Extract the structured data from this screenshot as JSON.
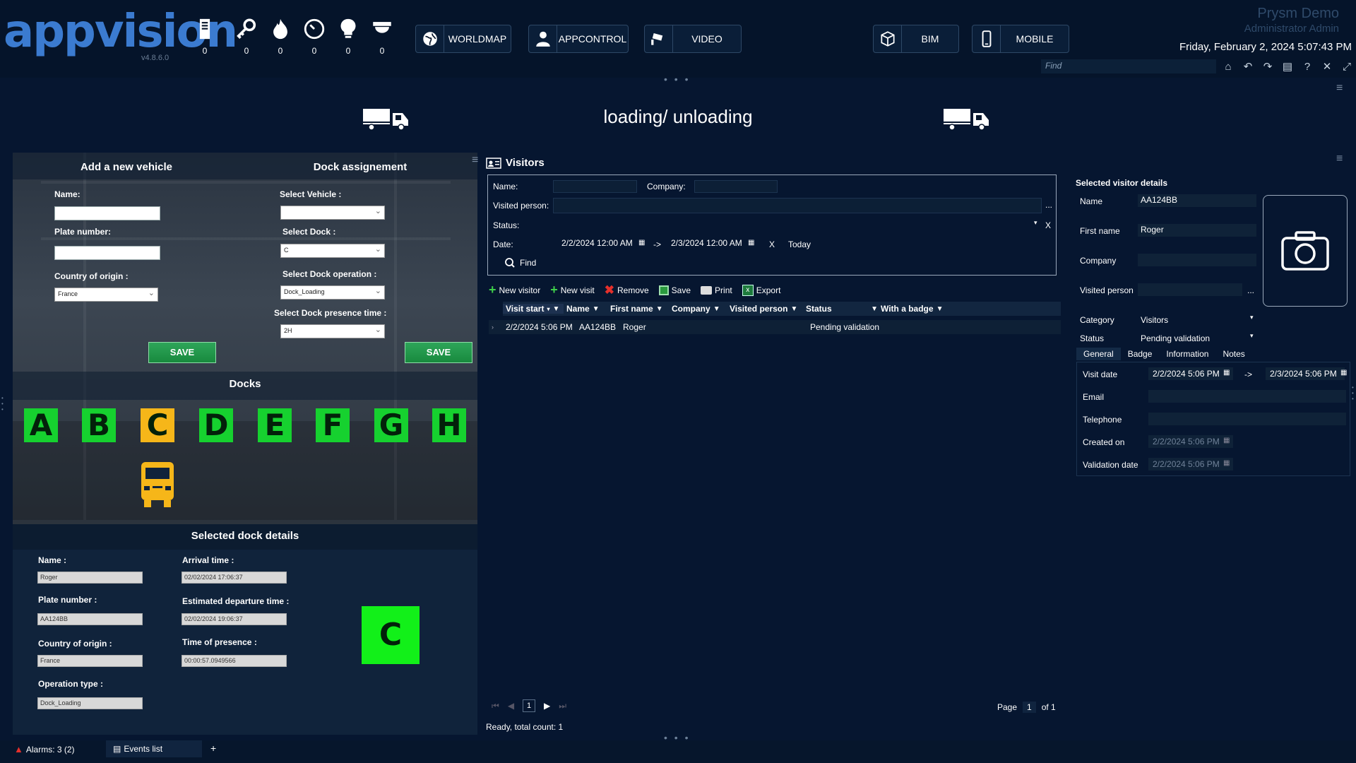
{
  "app": {
    "logo": "appvision",
    "version": "v4.8.6.0",
    "name": "Prysm Demo",
    "user": "Administrator Admin",
    "datetime": "Friday, February 2, 2024 5:07:43 PM",
    "find_placeholder": "Find"
  },
  "counters": [
    {
      "icon": "server-icon",
      "value": "0"
    },
    {
      "icon": "key-icon",
      "value": "0"
    },
    {
      "icon": "fire-icon",
      "value": "0"
    },
    {
      "icon": "gauge-icon",
      "value": "0"
    },
    {
      "icon": "lightbulb-icon",
      "value": "0"
    },
    {
      "icon": "camera-dome-icon",
      "value": "0"
    }
  ],
  "nav": {
    "worldmap": "WORLDMAP",
    "appcontrol": "APPCONTROL",
    "video": "VIDEO",
    "bim": "BIM",
    "mobile": "MOBILE"
  },
  "page": {
    "title": "loading/ unloading"
  },
  "vehicle": {
    "title": "Add a new vehicle",
    "name_label": "Name:",
    "plate_label": "Plate number:",
    "country_label": "Country of origin :",
    "country_value": "France",
    "save": "SAVE"
  },
  "dock_assign": {
    "title": "Dock assignement",
    "vehicle_label": "Select Vehicle :",
    "vehicle_value": "",
    "dock_label": "Select Dock :",
    "dock_value": "C",
    "operation_label": "Select Dock operation :",
    "operation_value": "Dock_Loading",
    "presence_label": "Select Dock presence time :",
    "presence_value": "2H",
    "save": "SAVE"
  },
  "docks": {
    "title": "Docks",
    "items": [
      "A",
      "B",
      "C",
      "D",
      "E",
      "F",
      "G",
      "H"
    ],
    "selected": "C",
    "colors": {
      "free": "#16d12f",
      "occupied": "#f6b619"
    }
  },
  "dock_details": {
    "title": "Selected dock details",
    "name_label": "Name :",
    "name_value": "Roger",
    "plate_label": "Plate number :",
    "plate_value": "AA124BB",
    "country_label": "Country of origin :",
    "country_value": "France",
    "operation_label": "Operation type :",
    "operation_value": "Dock_Loading",
    "arrival_label": "Arrival time :",
    "arrival_value": "02/02/2024 17:06:37",
    "departure_label": "Estimated departure time :",
    "departure_value": "02/02/2024 19:06:37",
    "presence_label": "Time of presence :",
    "presence_value": "00:00:57.0949566",
    "dock": "C"
  },
  "visitors": {
    "title": "Visitors",
    "filter": {
      "name_label": "Name:",
      "company_label": "Company:",
      "visited_label": "Visited person:",
      "status_label": "Status:",
      "date_label": "Date:",
      "date_from": "2/2/2024 12:00 AM",
      "arrow": "->",
      "date_to": "2/3/2024 12:00 AM",
      "clear": "X",
      "today": "Today",
      "find": "Find",
      "more": "...",
      "status_clear": "X"
    },
    "toolbar": {
      "new_visitor": "New visitor",
      "new_visit": "New visit",
      "remove": "Remove",
      "save": "Save",
      "print": "Print",
      "export": "Export"
    },
    "columns": [
      "Visit start",
      "Name",
      "First name",
      "Company",
      "Visited person",
      "Status",
      "With a badge"
    ],
    "rows": [
      {
        "visit_start": "2/2/2024 5:06 PM",
        "name": "AA124BB",
        "first_name": "Roger",
        "company": "",
        "visited_person": "",
        "status": "Pending validation",
        "badge": ""
      }
    ],
    "pager": {
      "current": "1",
      "page_label": "Page",
      "page_value": "1",
      "of_label": "of 1"
    },
    "status": "Ready, total count: 1"
  },
  "details": {
    "title": "Selected visitor details",
    "name_label": "Name",
    "name_value": "AA124BB",
    "first_label": "First name",
    "first_value": "Roger",
    "company_label": "Company",
    "company_value": "",
    "visited_label": "Visited person",
    "visited_value": "",
    "more": "...",
    "category_label": "Category",
    "category_value": "Visitors",
    "status_label": "Status",
    "status_value": "Pending validation",
    "tabs": [
      "General",
      "Badge",
      "Information",
      "Notes"
    ],
    "general": {
      "visit_label": "Visit date",
      "visit_from": "2/2/2024 5:06 PM",
      "arrow": "->",
      "visit_to": "2/3/2024 5:06 PM",
      "email_label": "Email",
      "phone_label": "Telephone",
      "created_label": "Created on",
      "created_value": "2/2/2024 5:06 PM",
      "validation_label": "Validation date",
      "validation_value": "2/2/2024 5:06 PM"
    }
  },
  "footer": {
    "alarms": "Alarms: 3 (2)",
    "events": "Events list",
    "add": "+"
  }
}
